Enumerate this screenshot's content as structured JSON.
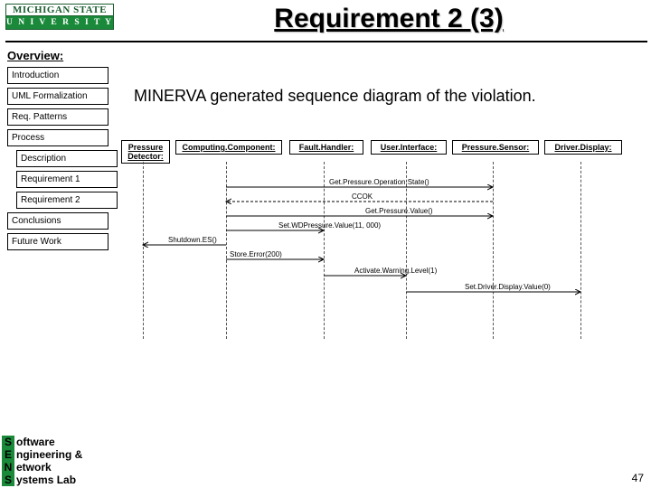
{
  "logo": {
    "top": "MICHIGAN STATE",
    "bottom": "U N I V E R S I T Y"
  },
  "title": "Requirement 2 (3)",
  "overview_label": "Overview:",
  "nav": {
    "items": [
      "Introduction",
      "UML Formalization",
      "Req. Patterns",
      "Process",
      "Description",
      "Requirement 1",
      "Requirement 2",
      "Conclusions",
      "Future Work"
    ]
  },
  "main_text": "MINERVA generated sequence diagram of the violation.",
  "seq": {
    "participants": [
      "Pressure\nDetector:",
      "Computing.Component:",
      "Fault.Handler:",
      "User.Interface:",
      "Pressure.Sensor:",
      "Driver.Display:"
    ],
    "messages": {
      "m0": "Get.Pressure.Operation.State()",
      "m1": "CCOK",
      "m2": "Get.Pressure.Value()",
      "m3": "Set.WDPressure.Value(11, 000)",
      "m4": "Shutdown.ES()",
      "m5": "Store.Error(200)",
      "m6": "Activate.Warning.Level(1)",
      "m7": "Set.Driver.Display.Value(0)"
    }
  },
  "footer": {
    "s": "S",
    "s_word": "oftware",
    "e": "E",
    "e_word": "ngineering &",
    "n": "N",
    "n_word": "etwork",
    "y": "S",
    "y_word": "ystems Lab"
  },
  "page_number": "47",
  "chart_data": {
    "type": "sequence-diagram",
    "participants": [
      "PressureDetector",
      "ComputingComponent",
      "FaultHandler",
      "UserInterface",
      "PressureSensor",
      "DriverDisplay"
    ],
    "messages": [
      {
        "from": "ComputingComponent",
        "to": "PressureSensor",
        "label": "Get.Pressure.Operation.State()",
        "dashed": false
      },
      {
        "from": "PressureSensor",
        "to": "ComputingComponent",
        "label": "CCOK",
        "dashed": true
      },
      {
        "from": "ComputingComponent",
        "to": "PressureSensor",
        "label": "Get.Pressure.Value()",
        "dashed": false
      },
      {
        "from": "ComputingComponent",
        "to": "FaultHandler",
        "label": "Set.WDPressure.Value(11, 000)",
        "dashed": false
      },
      {
        "from": "ComputingComponent",
        "to": "PressureDetector",
        "label": "Shutdown.ES()",
        "dashed": false
      },
      {
        "from": "ComputingComponent",
        "to": "FaultHandler",
        "label": "Store.Error(200)",
        "dashed": false
      },
      {
        "from": "FaultHandler",
        "to": "UserInterface",
        "label": "Activate.Warning.Level(1)",
        "dashed": false
      },
      {
        "from": "UserInterface",
        "to": "DriverDisplay",
        "label": "Set.Driver.Display.Value(0)",
        "dashed": false
      }
    ]
  }
}
